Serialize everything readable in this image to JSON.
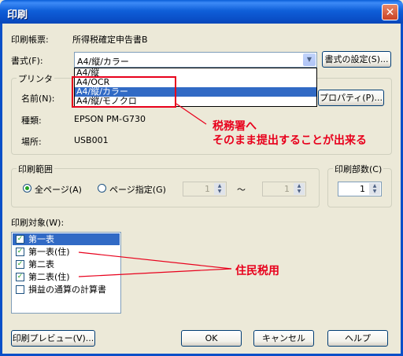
{
  "window": {
    "title": "印刷"
  },
  "form": {
    "label": "印刷帳票:",
    "value": "所得税確定申告書B"
  },
  "style": {
    "label": "書式(F):",
    "value": "A4/縦/カラー",
    "settings_button": "書式の設定(S)...",
    "options": [
      "A4/縦",
      "A4/OCR",
      "A4/縦/カラー",
      "A4/縦/モノクロ"
    ],
    "selected_index": 2
  },
  "printer": {
    "group_title": "プリンタ",
    "name_label": "名前(N):",
    "properties_button": "プロパティ(P)...",
    "type_label": "種類:",
    "type_value": "EPSON PM-G730",
    "location_label": "場所:",
    "location_value": "USB001"
  },
  "range": {
    "group_title": "印刷範囲",
    "all_pages": "全ページ(A)",
    "page_spec": "ページ指定(G)",
    "from": "1",
    "separator": "～",
    "to": "1",
    "selected": "all_pages"
  },
  "copies": {
    "group_title": "印刷部数(C)",
    "value": "1"
  },
  "targets": {
    "label": "印刷対象(W):",
    "items": [
      {
        "label": "第一表",
        "checked": true,
        "selected": true
      },
      {
        "label": "第一表(住)",
        "checked": true,
        "selected": false
      },
      {
        "label": "第二表",
        "checked": true,
        "selected": false
      },
      {
        "label": "第二表(住)",
        "checked": true,
        "selected": false
      },
      {
        "label": "損益の通算の計算書",
        "checked": false,
        "selected": false
      }
    ]
  },
  "buttons": {
    "preview": "印刷プレビュー(V)...",
    "ok": "OK",
    "cancel": "キャンセル",
    "help": "ヘルプ"
  },
  "annotations": {
    "tax_office_line1": "税務署へ",
    "tax_office_line2": "そのまま提出することが出来る",
    "resident_tax": "住民税用",
    "color": "#e8001c"
  }
}
